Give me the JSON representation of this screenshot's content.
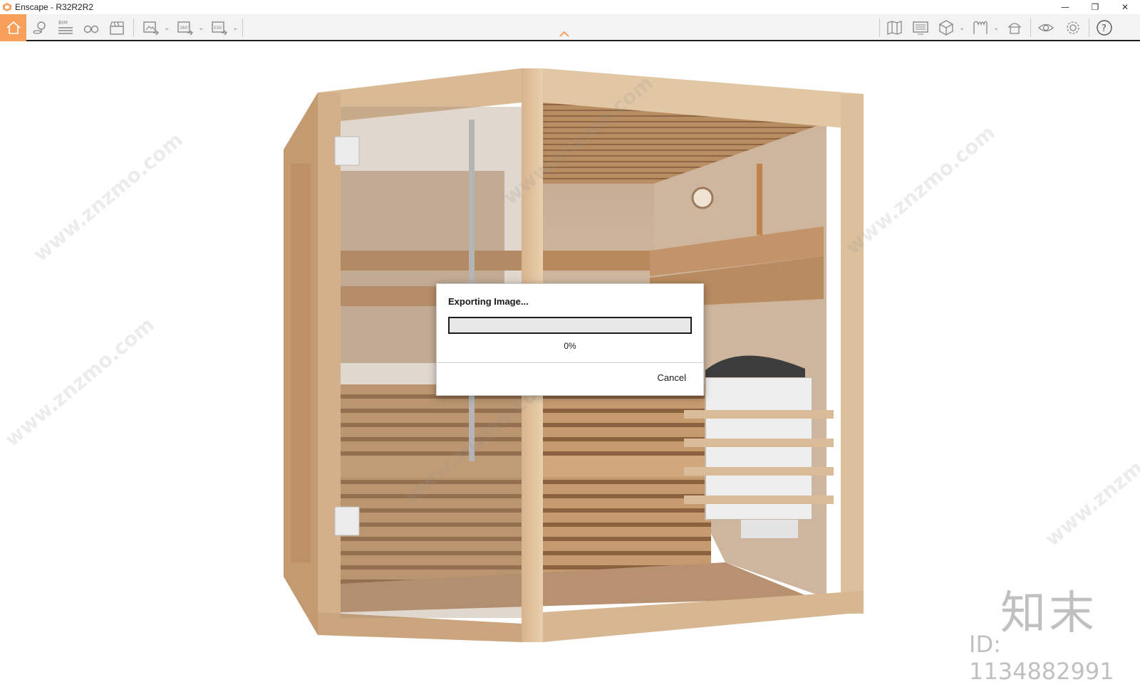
{
  "window": {
    "title": "Enscape - R32R2R2",
    "controls": {
      "minimize": "—",
      "restore": "❐",
      "close": "✕"
    }
  },
  "toolbar": {
    "left_icons": [
      "home-icon",
      "location-pin-icon",
      "bim-icon",
      "binoculars-icon",
      "clapperboard-icon"
    ],
    "bim_label": "BIM",
    "export_icons": [
      "export-screenshot-icon",
      "export-panorama-icon",
      "export-exe-icon"
    ],
    "panorama_label": "360°",
    "exe_label": "EXE",
    "right_icons": [
      "map-icon",
      "screen-icon",
      "cube-icon",
      "material-icon",
      "asset-library-icon",
      "visual-settings-icon",
      "settings-gear-icon",
      "help-icon"
    ],
    "help_label": "?",
    "accent_color": "#f7a05c"
  },
  "dialog": {
    "title": "Exporting Image...",
    "progress_value": 0,
    "progress_text": "0%",
    "cancel_label": "Cancel"
  },
  "watermark": {
    "brand_text": "www.znzmo.com",
    "logo_text": "知末",
    "id_text": "ID: 1134882991"
  }
}
